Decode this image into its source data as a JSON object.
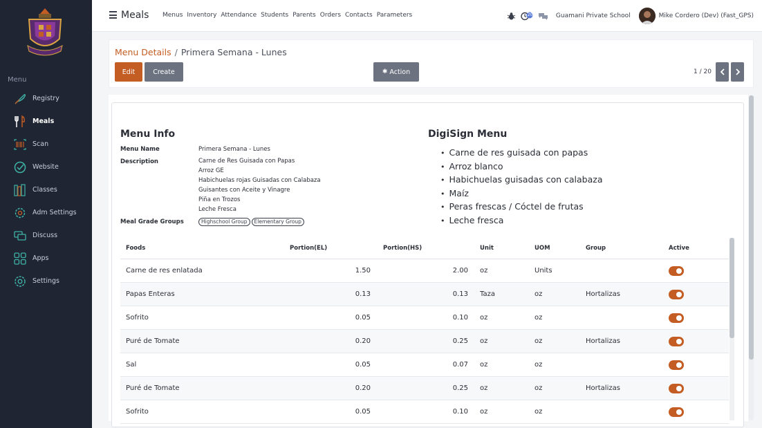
{
  "sidebar": {
    "menu_heading": "Menu",
    "items": [
      {
        "label": "Registry",
        "icon": "feather-icon"
      },
      {
        "label": "Meals",
        "icon": "fork-knife-icon"
      },
      {
        "label": "Scan",
        "icon": "barcode-icon"
      },
      {
        "label": "Website",
        "icon": "globe-check-icon"
      },
      {
        "label": "Classes",
        "icon": "books-icon"
      },
      {
        "label": "Adm Settings",
        "icon": "gear-icon"
      },
      {
        "label": "Discuss",
        "icon": "chat-icon"
      },
      {
        "label": "Apps",
        "icon": "apps-grid-icon"
      },
      {
        "label": "Settings",
        "icon": "gear-icon"
      }
    ],
    "active_item": "Meals"
  },
  "topbar": {
    "app_title": "Meals",
    "menu": [
      "Menus",
      "Inventory",
      "Attendance",
      "Students",
      "Parents",
      "Orders",
      "Contacts",
      "Parameters"
    ],
    "activity_count": "20",
    "company": "Guamani Private School",
    "user": "Mike Cordero (Dev) (Fast_GPS)"
  },
  "breadcrumb": {
    "parent": "Menu Details",
    "separator": "/",
    "current": "Primera Semana - Lunes"
  },
  "buttons": {
    "edit": "Edit",
    "create": "Create",
    "action": "Action"
  },
  "pager": "1 / 20",
  "menu_info": {
    "title": "Menu Info",
    "name_label": "Menu Name",
    "name_value": "Primera Semana - Lunes",
    "description_label": "Description",
    "description_lines": [
      "Carne de Res Guisada con Papas",
      "Arroz GE",
      "Habichuelas rojas Guisadas con Calabaza",
      "Guisantes con Aceite y Vinagre",
      "Piña en Trozos",
      "Leche Fresca"
    ],
    "groups_label": "Meal Grade Groups",
    "groups": [
      "Highschool Group",
      "Elementary Group"
    ]
  },
  "digisign": {
    "title": "DigiSign Menu",
    "items": [
      "Carne de res guisada con papas",
      "Arroz blanco",
      "Habichuelas guisadas con calabaza",
      "Maíz",
      "Peras frescas / Cóctel de frutas",
      "Leche fresca"
    ]
  },
  "foods_table": {
    "columns": [
      "Foods",
      "Portion(EL)",
      "Portion(HS)",
      "Unit",
      "UOM",
      "Group",
      "Active"
    ],
    "rows": [
      {
        "food": "Carne de res enlatada",
        "el": "1.50",
        "hs": "2.00",
        "unit": "oz",
        "uom": "Units",
        "group": "",
        "active": true
      },
      {
        "food": "Papas Enteras",
        "el": "0.13",
        "hs": "0.13",
        "unit": "Taza",
        "uom": "oz",
        "group": "Hortalizas",
        "active": true
      },
      {
        "food": "Sofrito",
        "el": "0.05",
        "hs": "0.10",
        "unit": "oz",
        "uom": "oz",
        "group": "",
        "active": true
      },
      {
        "food": "Puré de Tomate",
        "el": "0.20",
        "hs": "0.25",
        "unit": "oz",
        "uom": "oz",
        "group": "Hortalizas",
        "active": true
      },
      {
        "food": "Sal",
        "el": "0.05",
        "hs": "0.07",
        "unit": "oz",
        "uom": "oz",
        "group": "",
        "active": true
      },
      {
        "food": "Puré de Tomate",
        "el": "0.20",
        "hs": "0.25",
        "unit": "oz",
        "uom": "oz",
        "group": "Hortalizas",
        "active": true
      },
      {
        "food": "Sofrito",
        "el": "0.05",
        "hs": "0.10",
        "unit": "oz",
        "uom": "oz",
        "group": "",
        "active": true
      }
    ]
  },
  "colors": {
    "accent": "#c45d23",
    "sidebar_bg": "#1f2533",
    "secondary_button": "#6c7280"
  }
}
